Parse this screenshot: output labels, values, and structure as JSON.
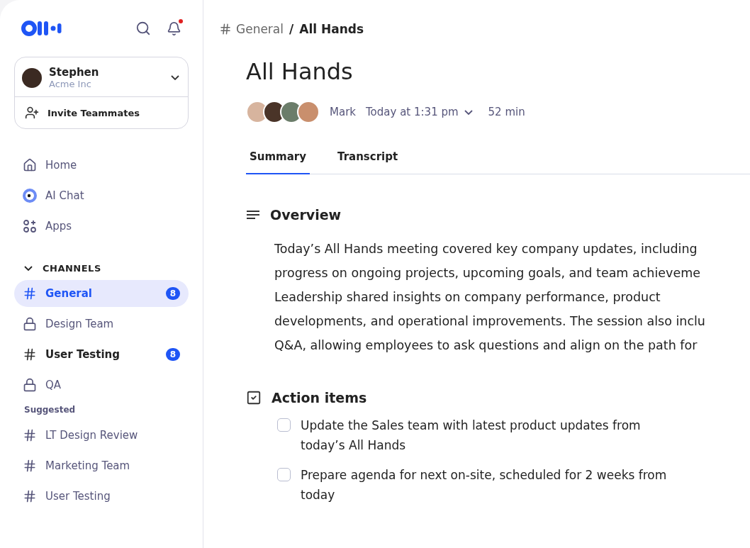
{
  "sidebar": {
    "user": {
      "name": "Stephen",
      "org": "Acme Inc"
    },
    "invite": "Invite Teammates",
    "notifications": true,
    "nav": [
      {
        "kind": "home",
        "label": "Home"
      },
      {
        "kind": "ai",
        "label": "AI Chat"
      },
      {
        "kind": "apps",
        "label": "Apps"
      }
    ],
    "channels_heading": "CHANNELS",
    "channels_expanded": true,
    "channels": [
      {
        "kind": "public",
        "name": "General",
        "selected": true,
        "unread": true,
        "badge": "8"
      },
      {
        "kind": "private",
        "name": "Design Team",
        "selected": false,
        "unread": false
      },
      {
        "kind": "public",
        "name": "User Testing",
        "selected": false,
        "unread": true,
        "badge": "8"
      },
      {
        "kind": "private",
        "name": "QA",
        "selected": false,
        "unread": false
      }
    ],
    "suggested_heading": "Suggested",
    "suggested": [
      {
        "kind": "public",
        "name": "LT Design Review",
        "selected": false,
        "unread": false
      },
      {
        "kind": "public",
        "name": "Marketing Team",
        "selected": false,
        "unread": false
      },
      {
        "kind": "public",
        "name": "User Testing",
        "selected": false,
        "unread": false
      }
    ]
  },
  "breadcrumb": {
    "channel": "General",
    "separator": "/",
    "page": "All Hands"
  },
  "meeting": {
    "title": "All Hands",
    "participants": [
      {
        "color": "#d7b49e"
      },
      {
        "color": "#4a3428"
      },
      {
        "color": "#6b7d6a"
      },
      {
        "color": "#c98f6d"
      }
    ],
    "host": "Mark",
    "time": "Today at 1:31 pm",
    "duration": "52 min"
  },
  "tabs": [
    {
      "label": "Summary",
      "selected": true
    },
    {
      "label": "Transcript",
      "selected": false
    }
  ],
  "overview": {
    "heading": "Overview",
    "lines": [
      "Today’s All Hands meeting covered key company updates, including",
      "progress on ongoing projects, upcoming goals, and team achieveme",
      "Leadership shared insights on company performance, product",
      "developments, and operational improvements. The session also inclu",
      "Q&A, allowing employees to ask questions and align on the path for"
    ]
  },
  "action_items": {
    "heading": "Action items",
    "items": [
      {
        "text": "Update the Sales team with latest product updates from today’s All Hands",
        "checked": false
      },
      {
        "text": "Prepare agenda for next on-site, scheduled for 2 weeks from today",
        "checked": false
      }
    ]
  }
}
